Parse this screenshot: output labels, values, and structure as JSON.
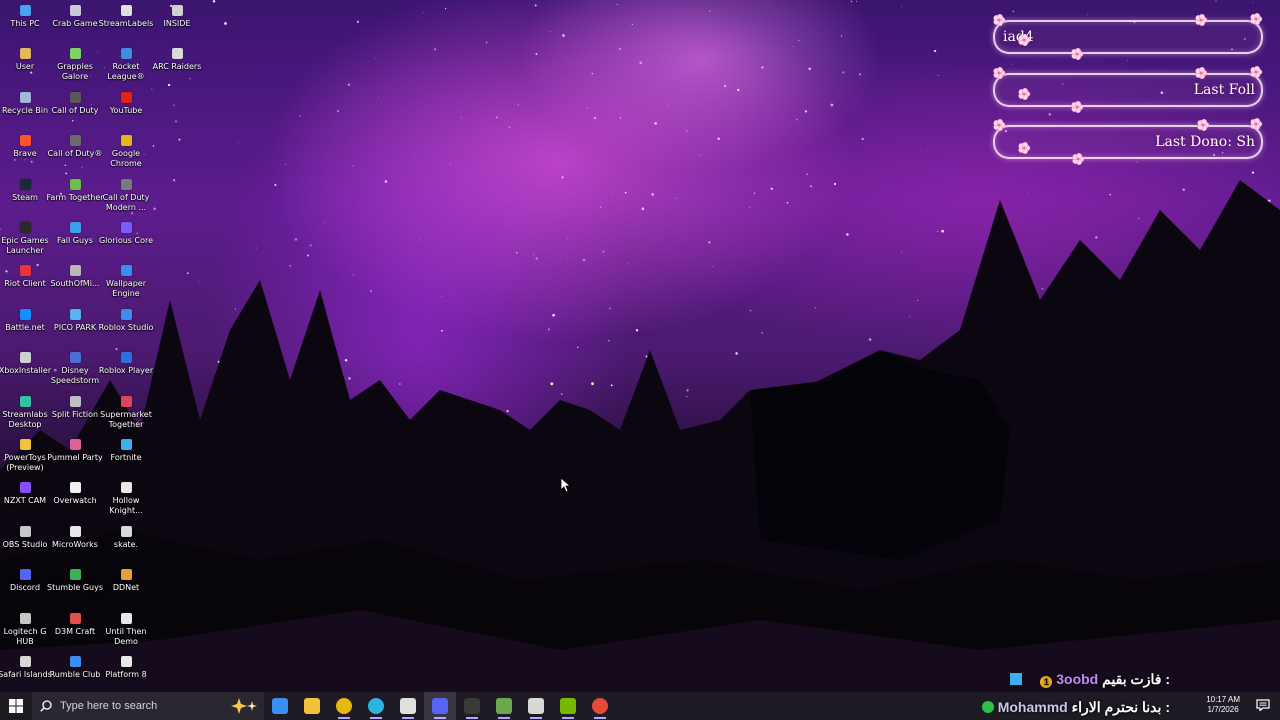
{
  "desktop": {
    "icons": [
      {
        "label": "This PC",
        "color": "#4aa3f0",
        "icon": "computer-icon"
      },
      {
        "label": "Crab Game",
        "color": "#c9c9d9",
        "icon": "crab-game-icon"
      },
      {
        "label": "StreamLabels",
        "color": "#e0e0e0",
        "icon": "streamlabels-icon"
      },
      {
        "label": "INSIDE",
        "color": "#d0d0d0",
        "icon": "inside-icon"
      },
      {
        "label": "User",
        "color": "#e3b85a",
        "icon": "user-folder-icon"
      },
      {
        "label": "Grapples Galore",
        "color": "#7bd36a",
        "icon": "grapples-galore-icon"
      },
      {
        "label": "Rocket League®",
        "color": "#3b8de0",
        "icon": "rocket-league-icon"
      },
      {
        "label": "ARC Raiders",
        "color": "#d9d9d9",
        "icon": "arc-raiders-icon"
      },
      {
        "label": "Recycle Bin",
        "color": "#9fb7d9",
        "icon": "recycle-bin-icon"
      },
      {
        "label": "Call of Duty",
        "color": "#5a5a5a",
        "icon": "call-of-duty-icon"
      },
      {
        "label": "YouTube",
        "color": "#e62117",
        "icon": "youtube-icon"
      },
      {
        "label": "Brave",
        "color": "#fb542b",
        "icon": "brave-icon"
      },
      {
        "label": "Call of Duty®",
        "color": "#6b6b6b",
        "icon": "call-of-duty-2-icon"
      },
      {
        "label": "Google Chrome",
        "color": "#e6b80f",
        "icon": "chrome-icon"
      },
      {
        "label": "Steam",
        "color": "#1b2838",
        "icon": "steam-icon"
      },
      {
        "label": "Farm Together",
        "color": "#6cc04a",
        "icon": "farm-together-icon"
      },
      {
        "label": "Call of Duty Modern ...",
        "color": "#7a7a7a",
        "icon": "cod-modern-icon"
      },
      {
        "label": "Epic Games Launcher",
        "color": "#2a2a2a",
        "icon": "epic-games-icon"
      },
      {
        "label": "Fall Guys",
        "color": "#3aa0f0",
        "icon": "fall-guys-icon"
      },
      {
        "label": "Glorious Core",
        "color": "#7a5cff",
        "icon": "glorious-core-icon"
      },
      {
        "label": "Riot Client",
        "color": "#e8323c",
        "icon": "riot-client-icon"
      },
      {
        "label": "SouthOfMi...",
        "color": "#b9b9b9",
        "icon": "southofmi-icon"
      },
      {
        "label": "Wallpaper Engine",
        "color": "#3a8ef0",
        "icon": "wallpaper-engine-icon"
      },
      {
        "label": "Battle.net",
        "color": "#148eff",
        "icon": "battlenet-icon"
      },
      {
        "label": "PICO PARK",
        "color": "#59b3f0",
        "icon": "pico-park-icon"
      },
      {
        "label": "Roblox Studio",
        "color": "#3a8ef0",
        "icon": "roblox-studio-icon"
      },
      {
        "label": "XboxInstaller",
        "color": "#d0d0d0",
        "icon": "xbox-installer-icon"
      },
      {
        "label": "Disney Speedstorm",
        "color": "#4a6fd8",
        "icon": "disney-speedstorm-icon"
      },
      {
        "label": "Roblox Player",
        "color": "#2f6fe0",
        "icon": "roblox-player-icon"
      },
      {
        "label": "Streamlabs Desktop",
        "color": "#31c3a2",
        "icon": "streamlabs-icon"
      },
      {
        "label": "Split Fiction",
        "color": "#c0c0c0",
        "icon": "split-fiction-icon"
      },
      {
        "label": "Supermarket Together",
        "color": "#e0445a",
        "icon": "supermarket-together-icon"
      },
      {
        "label": "PowerToys (Preview)",
        "color": "#f0c33a",
        "icon": "powertoys-icon"
      },
      {
        "label": "Pummel Party",
        "color": "#e0609a",
        "icon": "pummel-party-icon"
      },
      {
        "label": "Fortnite",
        "color": "#3ab0f0",
        "icon": "fortnite-icon"
      },
      {
        "label": "NZXT CAM",
        "color": "#8a4cff",
        "icon": "nzxt-cam-icon"
      },
      {
        "label": "Overwatch",
        "color": "#f0f0f0",
        "icon": "overwatch-icon"
      },
      {
        "label": "Hollow Knight...",
        "color": "#e8e8e8",
        "icon": "hollow-knight-icon"
      },
      {
        "label": "OBS Studio",
        "color": "#c8c8c8",
        "icon": "obs-studio-icon"
      },
      {
        "label": "MicroWorks",
        "color": "#e8e8e8",
        "icon": "microworks-icon"
      },
      {
        "label": "skate.",
        "color": "#d8d8d8",
        "icon": "skate-icon"
      },
      {
        "label": "Discord",
        "color": "#5865f2",
        "icon": "discord-icon"
      },
      {
        "label": "Stumble Guys",
        "color": "#3ab05a",
        "icon": "stumble-guys-icon"
      },
      {
        "label": "DDNet",
        "color": "#e8a030",
        "icon": "ddnet-icon"
      },
      {
        "label": "Logitech G HUB",
        "color": "#c8c8c8",
        "icon": "logitech-ghub-icon"
      },
      {
        "label": "D3M Craft",
        "color": "#e05050",
        "icon": "d3m-craft-icon"
      },
      {
        "label": "Until Then Demo",
        "color": "#e8e8e8",
        "icon": "until-then-icon"
      },
      {
        "label": "Safari Islands",
        "color": "#d8d8d8",
        "icon": "safari-islands-icon"
      },
      {
        "label": "Rumble Club",
        "color": "#3a8ef0",
        "icon": "rumble-club-icon"
      },
      {
        "label": "Platform 8",
        "color": "#e8e8e8",
        "icon": "platform-8-icon"
      }
    ]
  },
  "overlay": {
    "panel1": "iad4",
    "panel2": "Last Foll",
    "panel3": "Last Dono: Sh",
    "alert1_name": "3oobd",
    "alert1_text": "فازت بقيم :",
    "alert2_name": "Mohammd",
    "alert2_text": "بدنا نحترم الاراء :"
  },
  "taskbar": {
    "search_placeholder": "Type here to search",
    "time": "10:17 AM",
    "date": "1/7/2026",
    "apps": [
      {
        "name": "microsoft-store-icon",
        "color": "#3a8ef0"
      },
      {
        "name": "file-explorer-icon",
        "color": "#f0c33a"
      },
      {
        "name": "chrome-icon",
        "color": "#e6b80f"
      },
      {
        "name": "edge-icon",
        "color": "#2fb3e0"
      },
      {
        "name": "settings-gear-icon",
        "color": "#e0e0e0"
      },
      {
        "name": "discord-icon",
        "color": "#5865f2"
      },
      {
        "name": "obs-studio-icon",
        "color": "#3a3a3a"
      },
      {
        "name": "minecraft-icon",
        "color": "#6aa84f"
      },
      {
        "name": "package-icon",
        "color": "#d8d8d8"
      },
      {
        "name": "nvidia-icon",
        "color": "#76b900"
      },
      {
        "name": "chrome-profile-icon",
        "color": "#e84a3a"
      }
    ]
  }
}
